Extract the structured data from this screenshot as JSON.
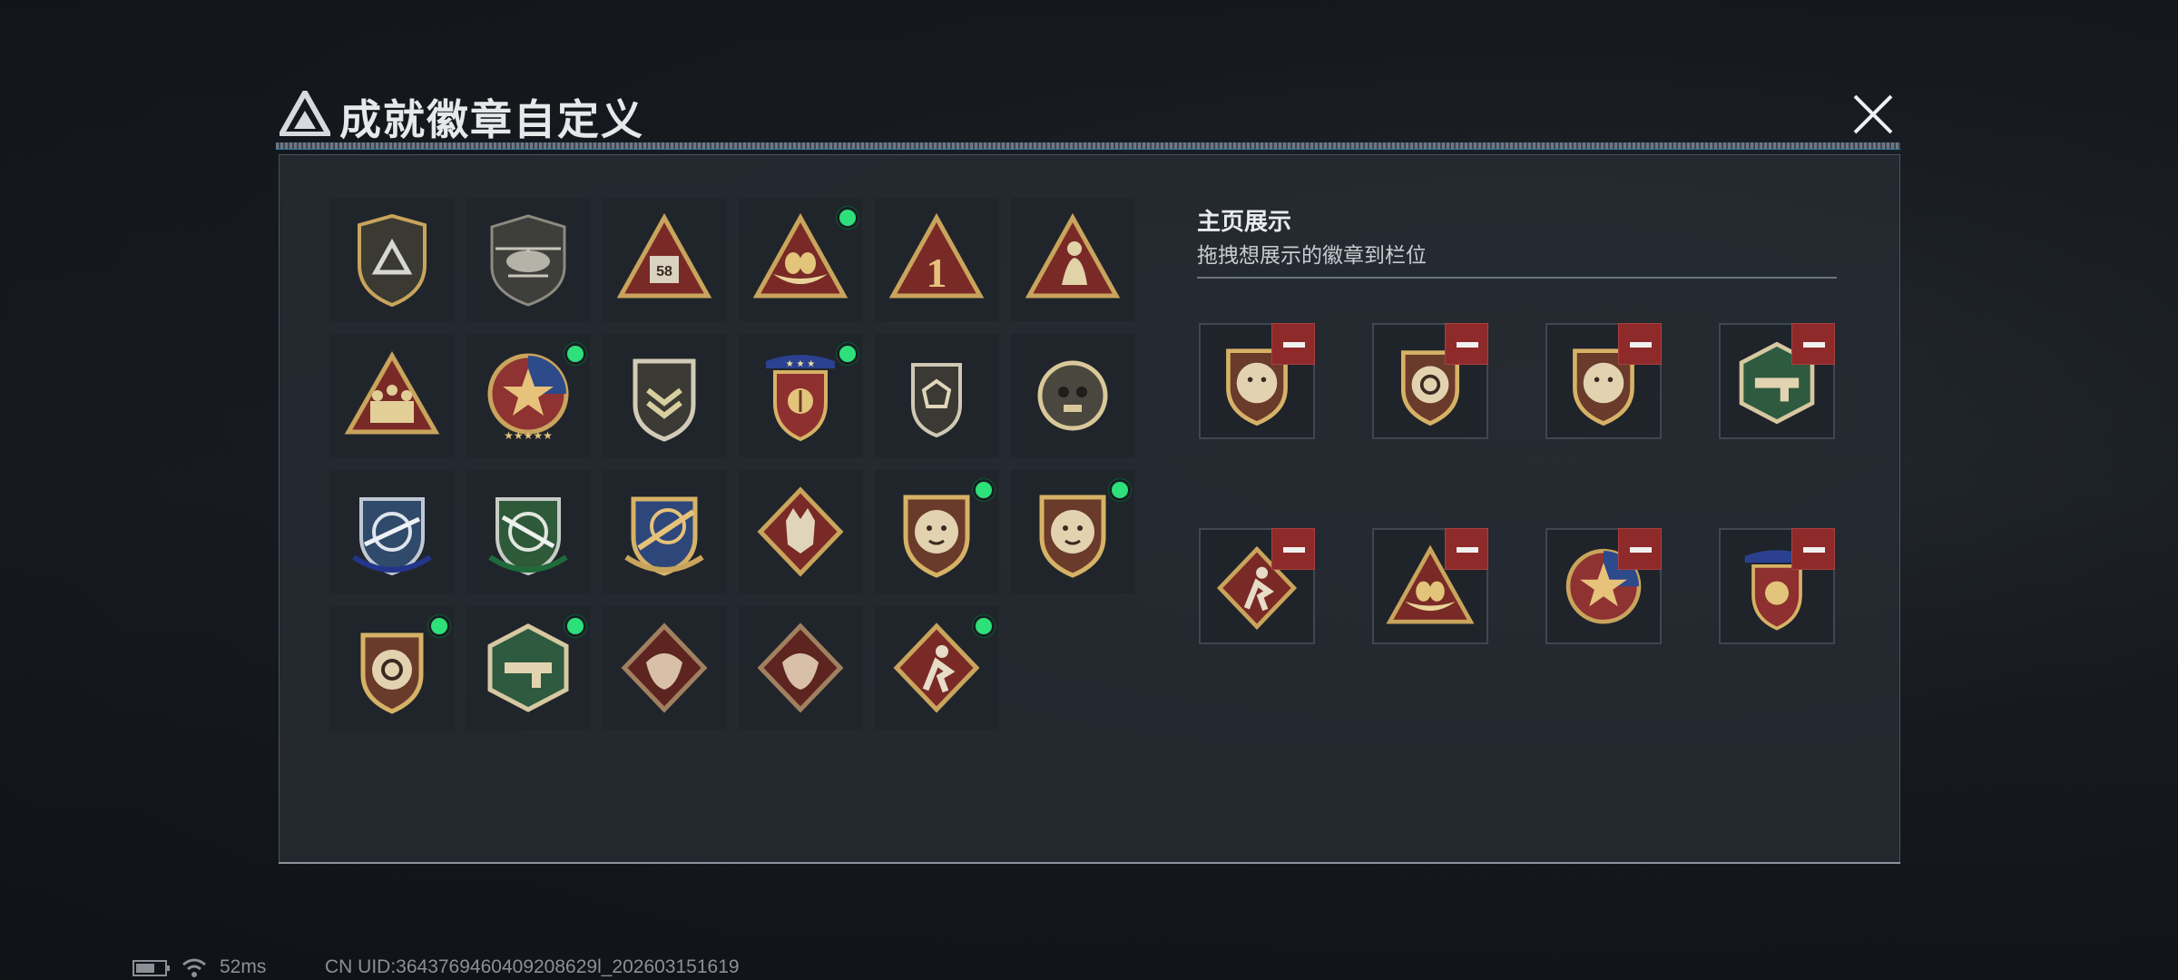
{
  "dialog": {
    "title": "成就徽章自定义",
    "close_icon": "close-x-icon"
  },
  "badge_grid": {
    "badges": [
      {
        "name": "triangle-logo-shield-badge",
        "selected": false
      },
      {
        "name": "helicopter-shield-badge",
        "selected": false
      },
      {
        "name": "58-triangle-badge",
        "selected": false,
        "text": "58"
      },
      {
        "name": "nest-eggs-triangle-badge",
        "selected": true
      },
      {
        "name": "number-1-triangle-badge",
        "selected": false,
        "text": "1"
      },
      {
        "name": "soldier-triangle-badge",
        "selected": false
      },
      {
        "name": "squad-triangle-badge",
        "selected": false
      },
      {
        "name": "star-round-badge",
        "selected": true
      },
      {
        "name": "rank-chevron-shield-badge",
        "selected": false
      },
      {
        "name": "laurel-blue-star-badge",
        "selected": true
      },
      {
        "name": "dice-shield-badge",
        "selected": false
      },
      {
        "name": "skull-gear-badge",
        "selected": false
      },
      {
        "name": "blue-sniper-crest-badge",
        "selected": false
      },
      {
        "name": "green-sniper-crest-badge",
        "selected": false
      },
      {
        "name": "gold-weapon-crest-badge",
        "selected": false
      },
      {
        "name": "wolf-diamond-badge",
        "selected": false
      },
      {
        "name": "lion-shield-badge-1",
        "selected": true
      },
      {
        "name": "lion-shield-badge-2",
        "selected": true
      },
      {
        "name": "target-shield-badge",
        "selected": true
      },
      {
        "name": "green-hexagon-weapon-badge",
        "selected": true
      },
      {
        "name": "dragon-diamond-badge-1",
        "selected": false
      },
      {
        "name": "dragon-diamond-badge-2",
        "selected": false
      },
      {
        "name": "runner-diamond-badge",
        "selected": true
      }
    ]
  },
  "homepage_display": {
    "title": "主页展示",
    "subtitle": "拖拽想展示的徽章到栏位",
    "slots": [
      {
        "badge": "lion-shield-badge"
      },
      {
        "badge": "target-shield-badge"
      },
      {
        "badge": "lion-shield-badge"
      },
      {
        "badge": "green-hexagon-weapon-badge"
      },
      {
        "badge": "runner-diamond-badge"
      },
      {
        "badge": "nest-eggs-triangle-badge"
      },
      {
        "badge": "star-round-badge"
      },
      {
        "badge": "laurel-blue-star-badge"
      }
    ],
    "remove_icon": "minus-icon"
  },
  "status_bar": {
    "battery_icon": "battery-icon",
    "wifi_icon": "wifi-icon",
    "ping": "52ms",
    "uid": "CN UID:3643769460409208629l_202603151619"
  },
  "colors": {
    "selected_dot": "#2ee07a",
    "remove_button": "#8e2a2a",
    "gold": "#c9a45c"
  }
}
